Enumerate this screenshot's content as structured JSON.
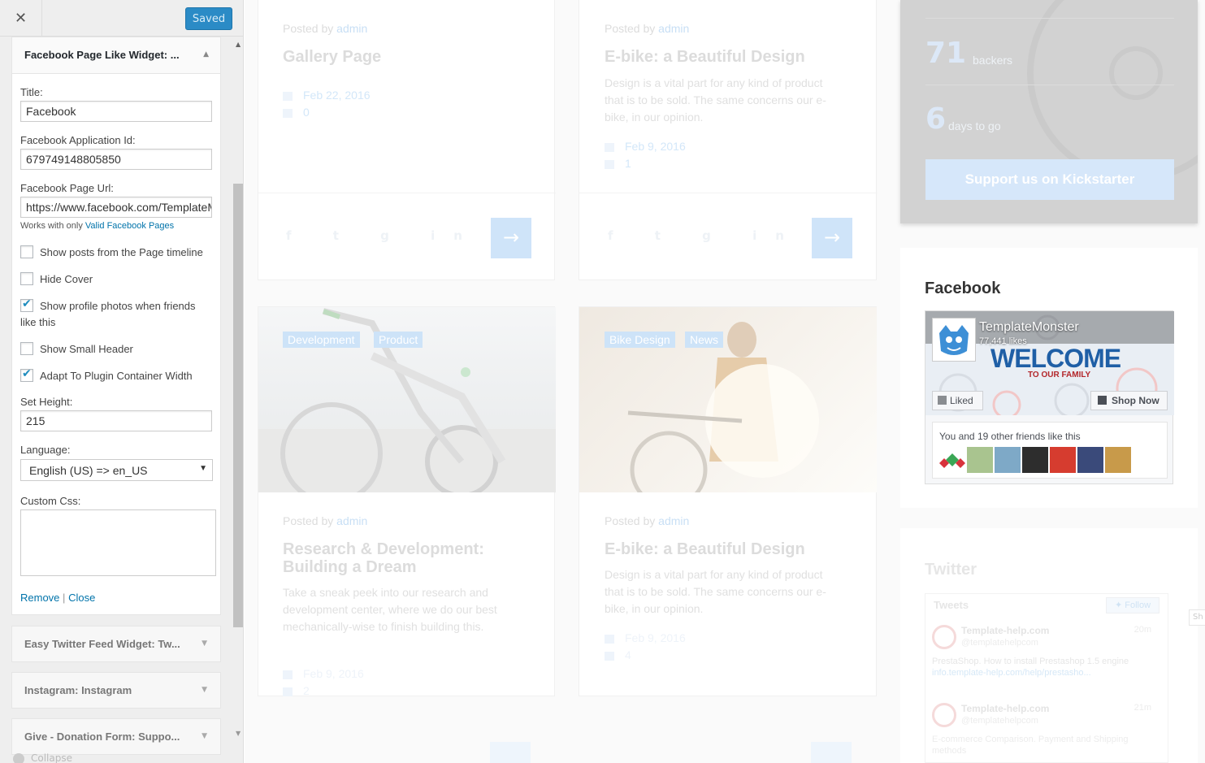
{
  "customizer": {
    "close_icon": "close-icon",
    "saved_label": "Saved",
    "widget": {
      "title": "Facebook Page Like Widget: ...",
      "fields": {
        "title_label": "Title:",
        "title_value": "Facebook",
        "app_id_label": "Facebook Application Id:",
        "app_id_value": "679749148805850",
        "page_url_label": "Facebook Page Url:",
        "page_url_value": "https://www.facebook.com/TemplateMonster",
        "page_url_note_prefix": "Works with only",
        "page_url_note_link": "Valid Facebook Pages"
      },
      "checkboxes": [
        {
          "label": "Show posts from the Page timeline",
          "checked": false
        },
        {
          "label": "Hide Cover",
          "checked": false
        },
        {
          "label": "Show profile photos when friends like this",
          "checked": true
        },
        {
          "label": "Show Small Header",
          "checked": false
        },
        {
          "label": "Adapt To Plugin Container Width",
          "checked": true
        }
      ],
      "height_label": "Set Height:",
      "height_value": "215",
      "language_label": "Language:",
      "language_value": "English (US) => en_US",
      "css_label": "Custom Css:",
      "remove_label": "Remove",
      "link_sep": "|",
      "close_label": "Close"
    },
    "collapsed_widgets": [
      {
        "title": "Easy Twitter Feed Widget: Tw..."
      },
      {
        "title": "Instagram: Instagram"
      },
      {
        "title": "Give - Donation Form: Suppo..."
      }
    ],
    "collapse_label": "Collapse"
  },
  "preview": {
    "posts": [
      {
        "posted_prefix": "Posted by",
        "author": "admin",
        "title": "Gallery Page",
        "excerpt": "",
        "date": "Feb 22, 2016",
        "comments": "0"
      },
      {
        "posted_prefix": "Posted by",
        "author": "admin",
        "title": "E-bike: a Beautiful Design",
        "excerpt": "Design is a vital part for any kind of product that is to be sold. The same concerns our e-bike, in our opinion.",
        "date": "Feb 9, 2016",
        "comments": "1"
      },
      {
        "posted_prefix": "Posted by",
        "author": "admin",
        "title": "Research & Development: Building a Dream",
        "excerpt": "Take a sneak peek into our research and development center, where we do our best mechanically-wise to finish building this.",
        "date": "Feb 9, 2016",
        "comments": "2",
        "tags": [
          "Development",
          "Product"
        ]
      },
      {
        "posted_prefix": "Posted by",
        "author": "admin",
        "title": "E-bike: a Beautiful Design",
        "excerpt": "Design is a vital part for any kind of product that is to be sold. The same concerns our e-bike, in our opinion.",
        "date": "Feb 9, 2016",
        "comments": "4",
        "tags": [
          "Bike Design",
          "News"
        ]
      }
    ],
    "social_icons": [
      "facebook-icon",
      "twitter-icon",
      "google-plus-icon",
      "linkedin-icon",
      "pinterest-icon"
    ],
    "kickstarter": {
      "backers_num": "71",
      "backers_label": "backers",
      "days_num": "6",
      "days_label": "days to go",
      "button": "Support us on Kickstarter"
    },
    "facebook": {
      "heading": "Facebook",
      "page_name": "TemplateMonster",
      "likes": "77,441 likes",
      "welcome": "WELCOME",
      "family": "TO OUR FAMILY",
      "liked_label": "Liked",
      "shop_label": "Shop Now",
      "friends_text": "You and 19 other friends like this"
    },
    "twitter": {
      "heading": "Twitter",
      "tweets_label": "Tweets",
      "follow_label": "Follow",
      "tweets": [
        {
          "name": "Template-help.com",
          "handle": "@templatehelpcom",
          "time": "20m",
          "text": "PrestaShop. How to install Prestashop 1.5 engine",
          "link": "info.template-help.com/help/prestasho..."
        },
        {
          "name": "Template-help.com",
          "handle": "@templatehelpcom",
          "time": "21m",
          "text": "E-commerce Comparison. Payment and Shipping methods",
          "link": ""
        }
      ],
      "share_tab": "Sh"
    }
  }
}
